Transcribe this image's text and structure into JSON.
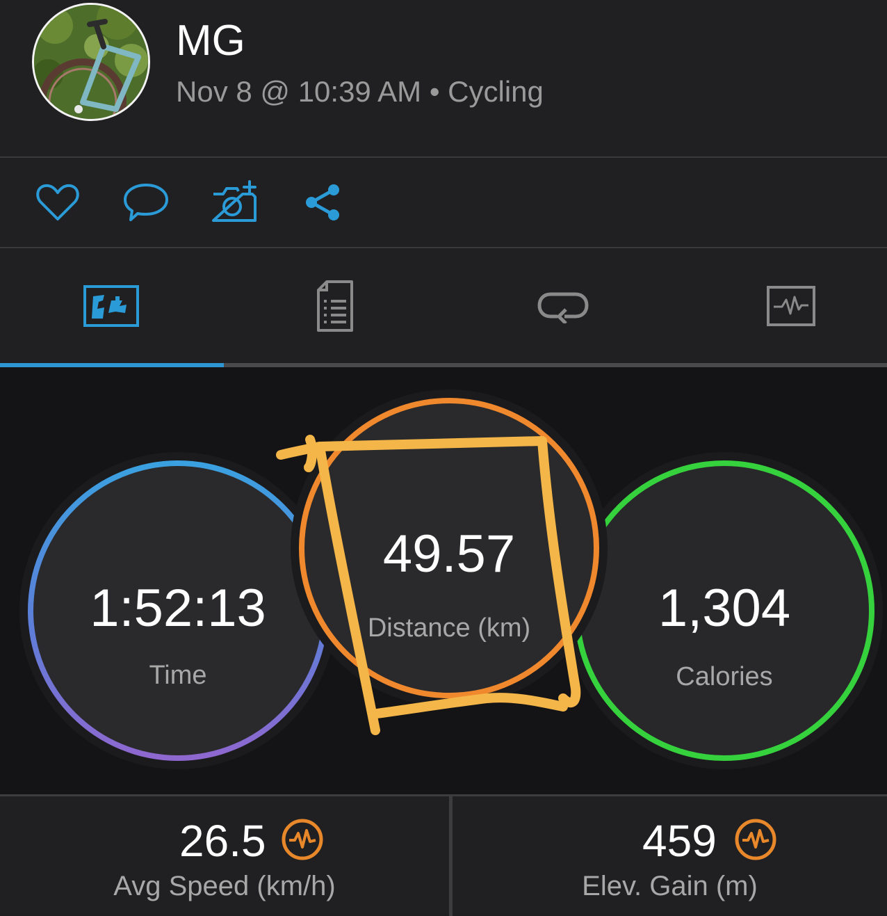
{
  "header": {
    "user_name": "MG",
    "activity_meta": "Nov 8 @ 10:39 AM • Cycling"
  },
  "actions": [
    {
      "name": "like",
      "icon": "heart-icon"
    },
    {
      "name": "comment",
      "icon": "speech-bubble-icon"
    },
    {
      "name": "add-photo",
      "icon": "camera-plus-icon"
    },
    {
      "name": "share",
      "icon": "share-icon"
    }
  ],
  "tabs": [
    {
      "name": "overview",
      "icon": "stats-overview-icon",
      "selected": true
    },
    {
      "name": "details",
      "icon": "document-list-icon",
      "selected": false
    },
    {
      "name": "laps",
      "icon": "laps-loop-icon",
      "selected": false
    },
    {
      "name": "charts",
      "icon": "activity-chart-icon",
      "selected": false
    }
  ],
  "rings": {
    "time": {
      "value": "1:52:13",
      "label": "Time",
      "color": "#3aa1e0"
    },
    "distance": {
      "value": "49.57",
      "label": "Distance (km)",
      "color": "#f0892d"
    },
    "calories": {
      "value": "1,304",
      "label": "Calories",
      "color": "#36d23e"
    }
  },
  "bottom_stats": {
    "avg_speed": {
      "value": "26.5",
      "label": "Avg Speed (km/h)",
      "icon": "pulse-badge-icon"
    },
    "elev_gain": {
      "value": "459",
      "label": "Elev. Gain (m)",
      "icon": "pulse-badge-icon"
    }
  },
  "colors": {
    "accent_blue": "#2f96d4",
    "icon_blue": "#2b9bd8",
    "highlight": "#f4b648",
    "badge_orange": "#e8882a"
  }
}
